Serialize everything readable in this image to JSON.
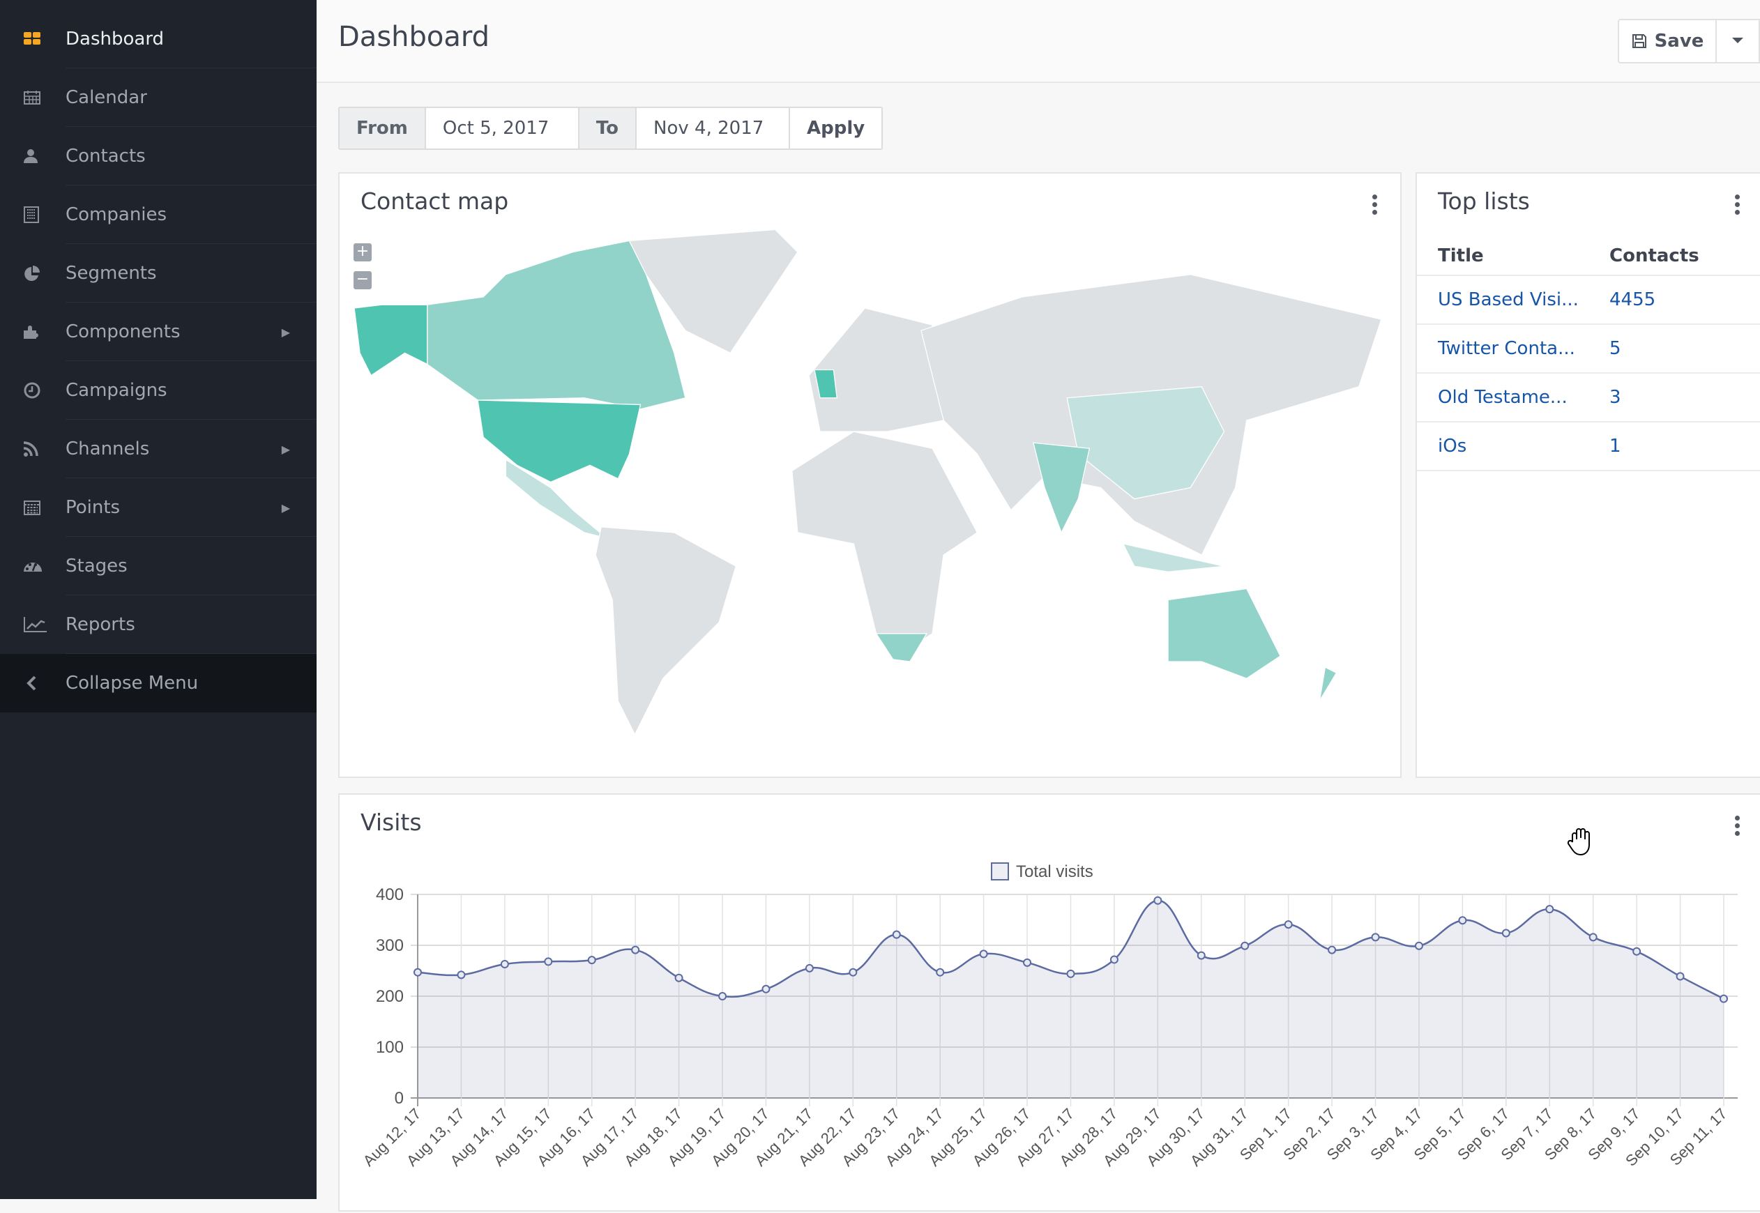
{
  "sidebar": {
    "items": [
      {
        "label": "Dashboard",
        "icon": "dashboard-icon",
        "active": true
      },
      {
        "label": "Calendar",
        "icon": "calendar-icon"
      },
      {
        "label": "Contacts",
        "icon": "user-icon"
      },
      {
        "label": "Companies",
        "icon": "building-icon"
      },
      {
        "label": "Segments",
        "icon": "pie-chart-icon"
      },
      {
        "label": "Components",
        "icon": "puzzle-icon",
        "submenu": true
      },
      {
        "label": "Campaigns",
        "icon": "clock-icon"
      },
      {
        "label": "Channels",
        "icon": "rss-icon",
        "submenu": true
      },
      {
        "label": "Points",
        "icon": "calculator-icon",
        "submenu": true
      },
      {
        "label": "Stages",
        "icon": "tachometer-icon"
      },
      {
        "label": "Reports",
        "icon": "line-chart-icon"
      }
    ],
    "collapse_label": "Collapse Menu",
    "accent": "#f5a623"
  },
  "header": {
    "title": "Dashboard",
    "save_label": "Save"
  },
  "datebar": {
    "from_label": "From",
    "from_value": "Oct 5, 2017",
    "to_label": "To",
    "to_value": "Nov 4, 2017",
    "apply_label": "Apply"
  },
  "contact_map": {
    "title": "Contact map",
    "zoom_in": "+",
    "zoom_out": "−",
    "colors": {
      "high": "#4fc4b0",
      "medium": "#92d3c9",
      "low": "#c3e2df",
      "none": "#dde1e4"
    }
  },
  "top_lists": {
    "title": "Top lists",
    "columns": [
      "Title",
      "Contacts"
    ],
    "rows": [
      {
        "title": "US Based Visi...",
        "contacts": "4455"
      },
      {
        "title": "Twitter Conta...",
        "contacts": "5"
      },
      {
        "title": "Old Testame...",
        "contacts": "3"
      },
      {
        "title": "iOs",
        "contacts": "1"
      }
    ]
  },
  "visits": {
    "title": "Visits"
  },
  "chart_data": {
    "type": "line",
    "legend": "top",
    "ylim": [
      0,
      400
    ],
    "yticks": [
      0,
      100,
      200,
      300,
      400
    ],
    "grid": true,
    "fill": true,
    "color": "#5b6aa0",
    "series": [
      {
        "name": "Total visits",
        "values": [
          247,
          242,
          263,
          268,
          271,
          291,
          236,
          200,
          214,
          255,
          247,
          321,
          247,
          283,
          266,
          244,
          272,
          388,
          280,
          299,
          341,
          291,
          316,
          299,
          349,
          324,
          371,
          316,
          288,
          239,
          195
        ]
      }
    ],
    "categories": [
      "Aug 12, 17",
      "Aug 13, 17",
      "Aug 14, 17",
      "Aug 15, 17",
      "Aug 16, 17",
      "Aug 17, 17",
      "Aug 18, 17",
      "Aug 19, 17",
      "Aug 20, 17",
      "Aug 21, 17",
      "Aug 22, 17",
      "Aug 23, 17",
      "Aug 24, 17",
      "Aug 25, 17",
      "Aug 26, 17",
      "Aug 27, 17",
      "Aug 28, 17",
      "Aug 29, 17",
      "Aug 30, 17",
      "Aug 31, 17",
      "Sep 1, 17",
      "Sep 2, 17",
      "Sep 3, 17",
      "Sep 4, 17",
      "Sep 5, 17",
      "Sep 6, 17",
      "Sep 7, 17",
      "Sep 8, 17",
      "Sep 9, 17",
      "Sep 10, 17",
      "Sep 11, 17"
    ]
  }
}
